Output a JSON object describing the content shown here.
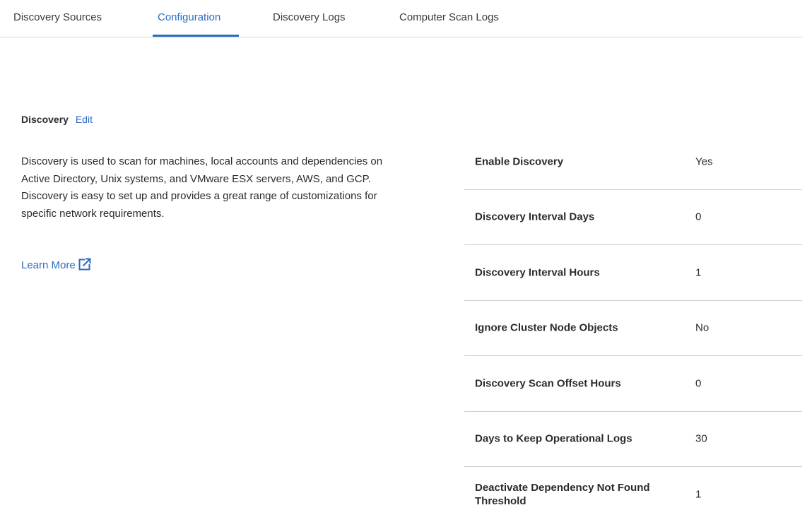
{
  "tabs": [
    {
      "label": "Discovery Sources",
      "active": false
    },
    {
      "label": "Configuration",
      "active": true
    },
    {
      "label": "Discovery Logs",
      "active": false
    },
    {
      "label": "Computer Scan Logs",
      "active": false
    }
  ],
  "section": {
    "title": "Discovery",
    "edit_label": "Edit",
    "description": "Discovery is used to scan for machines, local accounts and dependencies on Active Directory, Unix systems, and VMware ESX servers, AWS, and GCP. Discovery is easy to set up and provides a great range of customizations for specific network requirements.",
    "learn_more_label": "Learn More",
    "learn_more_icon": "external-link-icon"
  },
  "properties": [
    {
      "label": "Enable Discovery",
      "value": "Yes"
    },
    {
      "label": "Discovery Interval Days",
      "value": "0"
    },
    {
      "label": "Discovery Interval Hours",
      "value": "1"
    },
    {
      "label": "Ignore Cluster Node Objects",
      "value": "No"
    },
    {
      "label": "Discovery Scan Offset Hours",
      "value": "0"
    },
    {
      "label": "Days to Keep Operational Logs",
      "value": "30"
    },
    {
      "label": "Deactivate Dependency Not Found Threshold",
      "value": "1"
    }
  ],
  "colors": {
    "accent": "#2b6cc4",
    "text": "#2b2b2b",
    "divider": "#cfcfcf"
  }
}
